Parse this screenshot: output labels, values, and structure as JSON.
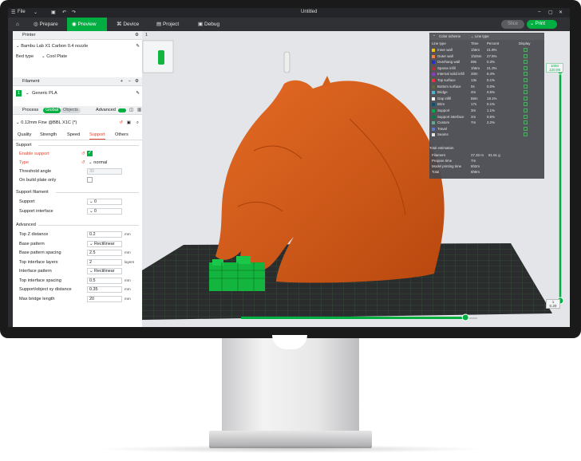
{
  "app": {
    "title": "Untitled",
    "file_menu": "File"
  },
  "nav": {
    "tabs": [
      "Prepare",
      "Preview",
      "Device",
      "Project",
      "Debug"
    ],
    "active": "Preview",
    "slice_label": "Slice",
    "print_label": "Print"
  },
  "printer": {
    "section": "Printer",
    "name": "Bambu Lab X1 Carbon 0.4 nozzle",
    "bed_type_label": "Bed type",
    "bed_type": "Cool Plate"
  },
  "filament": {
    "section": "Filament",
    "slot": "1",
    "name": "Generic PLA"
  },
  "process": {
    "section": "Process",
    "global": "Global",
    "objects": "Objects",
    "advanced": "Advanced",
    "profile": "0.12mm Fine @BBL X1C (*)",
    "tabs": [
      "Quality",
      "Strength",
      "Speed",
      "Support",
      "Others"
    ],
    "active_tab": "Support"
  },
  "support": {
    "group": "Support",
    "enable_label": "Enable support",
    "type_label": "Type",
    "type_value": "normal",
    "threshold_label": "Threshold angle",
    "threshold_value": "30",
    "build_plate_only_label": "On build plate only"
  },
  "support_filament": {
    "group": "Support filament",
    "support_label": "Support",
    "support_value": "0",
    "interface_label": "Support interface",
    "interface_value": "0"
  },
  "advanced": {
    "group": "Advanced",
    "rows": [
      {
        "label": "Top Z distance",
        "value": "0.2",
        "unit": "mm"
      },
      {
        "label": "Base pattern",
        "value": "Rectilinear",
        "unit": ""
      },
      {
        "label": "Base pattern spacing",
        "value": "2.5",
        "unit": "mm"
      },
      {
        "label": "Top interface layers",
        "value": "2",
        "unit": "layers"
      },
      {
        "label": "Interface pattern",
        "value": "Rectilinear",
        "unit": ""
      },
      {
        "label": "Top interface spacing",
        "value": "0.5",
        "unit": "mm"
      },
      {
        "label": "Support/object xy distance",
        "value": "0.35",
        "unit": "mm"
      },
      {
        "label": "Max bridge length",
        "value": "20",
        "unit": "mm"
      }
    ]
  },
  "legend": {
    "scheme_label": "Color scheme",
    "scheme_value": "Line type",
    "headers": [
      "Line type",
      "Time",
      "Percent",
      "Display"
    ],
    "rows": [
      {
        "name": "Inner wall",
        "time": "1h6m",
        "percent": "21.9%",
        "color": "#f2c200"
      },
      {
        "name": "Outer wall",
        "time": "1h25m",
        "percent": "27.5%",
        "color": "#ff7d38"
      },
      {
        "name": "Overhang wall",
        "time": "59s",
        "percent": "0.3%",
        "color": "#2b2bc8"
      },
      {
        "name": "Sparse infill",
        "time": "1h6m",
        "percent": "21.3%",
        "color": "#b33333"
      },
      {
        "name": "Internal solid infill",
        "time": "20m",
        "percent": "6.4%",
        "color": "#9933cc"
      },
      {
        "name": "Top surface",
        "time": "13s",
        "percent": "0.1%",
        "color": "#ff3333"
      },
      {
        "name": "Bottom surface",
        "time": "0s",
        "percent": "0.0%",
        "color": "#666633"
      },
      {
        "name": "Bridge",
        "time": "2m",
        "percent": "0.5%",
        "color": "#4db3cc"
      },
      {
        "name": "Gap infill",
        "time": "56m",
        "percent": "18.1%",
        "color": "#ffffff"
      },
      {
        "name": "Brim",
        "time": "17s",
        "percent": "0.1%",
        "color": "#00577a"
      },
      {
        "name": "Support",
        "time": "3m",
        "percent": "1.1%",
        "color": "#00ae42"
      },
      {
        "name": "Support interface",
        "time": "2m",
        "percent": "0.6%",
        "color": "#00803a"
      },
      {
        "name": "Custom",
        "time": "7m",
        "percent": "2.2%",
        "color": "#5ea98f"
      },
      {
        "name": "Travel",
        "time": "",
        "percent": "",
        "color": "#5a7ad0"
      },
      {
        "name": "Seams",
        "time": "",
        "percent": "",
        "color": "#e6e6e6"
      }
    ],
    "total_label": "Total estimation",
    "filament_label": "Filament",
    "filament_length": "27.33 m",
    "filament_weight": "81.51 g",
    "prepare_label": "Prepare time",
    "prepare_value": "7m",
    "model_time_label": "Model printing time",
    "model_time_value": "5h2m",
    "total_time_label": "Total",
    "total_time_value": "5h9m"
  },
  "layer_slider": {
    "top_label": "1094",
    "top_height": "120.06",
    "bottom_label": "1",
    "bottom_height": "0.20"
  },
  "plate": {
    "number": "1"
  },
  "horizontal_slider": {
    "level": 0.95
  }
}
